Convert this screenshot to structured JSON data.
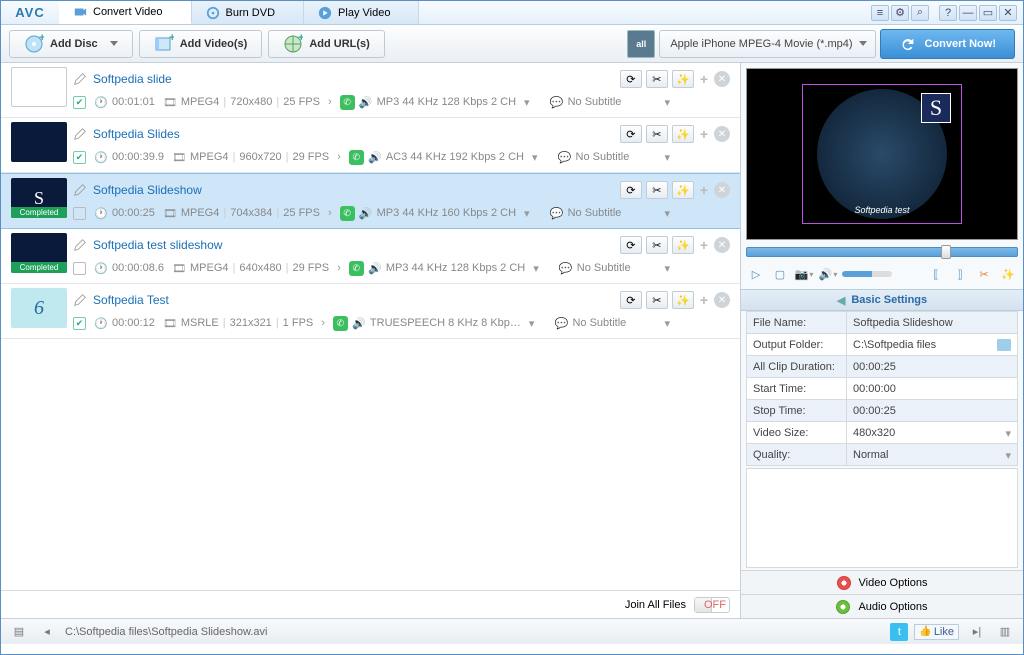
{
  "app": {
    "logo": "AVC"
  },
  "tabs": [
    {
      "label": "Convert Video",
      "active": true
    },
    {
      "label": "Burn DVD",
      "active": false
    },
    {
      "label": "Play Video",
      "active": false
    }
  ],
  "toolbar": {
    "add_disc": "Add Disc",
    "add_videos": "Add Video(s)",
    "add_urls": "Add URL(s)",
    "profile_tag": "all",
    "profile": "Apple iPhone MPEG-4 Movie (*.mp4)",
    "convert": "Convert Now!"
  },
  "items": [
    {
      "title": "Softpedia slide",
      "checked": true,
      "duration": "00:01:01",
      "video": "MPEG4",
      "res": "720x480",
      "fps": "25 FPS",
      "audio": "MP3 44 KHz 128 Kbps 2 CH",
      "subtitle": "No Subtitle",
      "completed": false,
      "thumb": "white",
      "selected": false
    },
    {
      "title": "Softpedia Slides",
      "checked": true,
      "duration": "00:00:39.9",
      "video": "MPEG4",
      "res": "960x720",
      "fps": "29 FPS",
      "audio": "AC3 44 KHz 192 Kbps 2 CH",
      "subtitle": "No Subtitle",
      "completed": false,
      "thumb": "dark",
      "selected": false
    },
    {
      "title": "Softpedia Slideshow",
      "checked": false,
      "duration": "00:00:25",
      "video": "MPEG4",
      "res": "704x384",
      "fps": "25 FPS",
      "audio": "MP3 44 KHz 160 Kbps 2 CH",
      "subtitle": "No Subtitle",
      "completed": true,
      "thumb": "dark",
      "selected": true
    },
    {
      "title": "Softpedia test slideshow",
      "checked": false,
      "duration": "00:00:08.6",
      "video": "MPEG4",
      "res": "640x480",
      "fps": "29 FPS",
      "audio": "MP3 44 KHz 128 Kbps 2 CH",
      "subtitle": "No Subtitle",
      "completed": true,
      "thumb": "dark",
      "selected": false
    },
    {
      "title": "Softpedia Test",
      "checked": true,
      "duration": "00:00:12",
      "video": "MSRLE",
      "res": "321x321",
      "fps": "1 FPS",
      "audio": "TRUESPEECH 8 KHz 8 Kbp…",
      "subtitle": "No Subtitle",
      "completed": false,
      "thumb": "light",
      "selected": false
    }
  ],
  "badge_completed": "Completed",
  "join": {
    "label": "Join All Files",
    "toggle": "OFF"
  },
  "preview": {
    "letter": "S",
    "caption": "Softpedia test"
  },
  "settings_header": "Basic Settings",
  "settings": {
    "file_name_k": "File Name:",
    "file_name_v": "Softpedia Slideshow",
    "out_folder_k": "Output Folder:",
    "out_folder_v": "C:\\Softpedia files",
    "all_dur_k": "All Clip Duration:",
    "all_dur_v": "00:00:25",
    "start_k": "Start Time:",
    "start_v": "00:00:00",
    "stop_k": "Stop Time:",
    "stop_v": "00:00:25",
    "vsize_k": "Video Size:",
    "vsize_v": "480x320",
    "quality_k": "Quality:",
    "quality_v": "Normal"
  },
  "video_options": "Video Options",
  "audio_options": "Audio Options",
  "status_path": "C:\\Softpedia files\\Softpedia Slideshow.avi",
  "fb_like": "Like"
}
